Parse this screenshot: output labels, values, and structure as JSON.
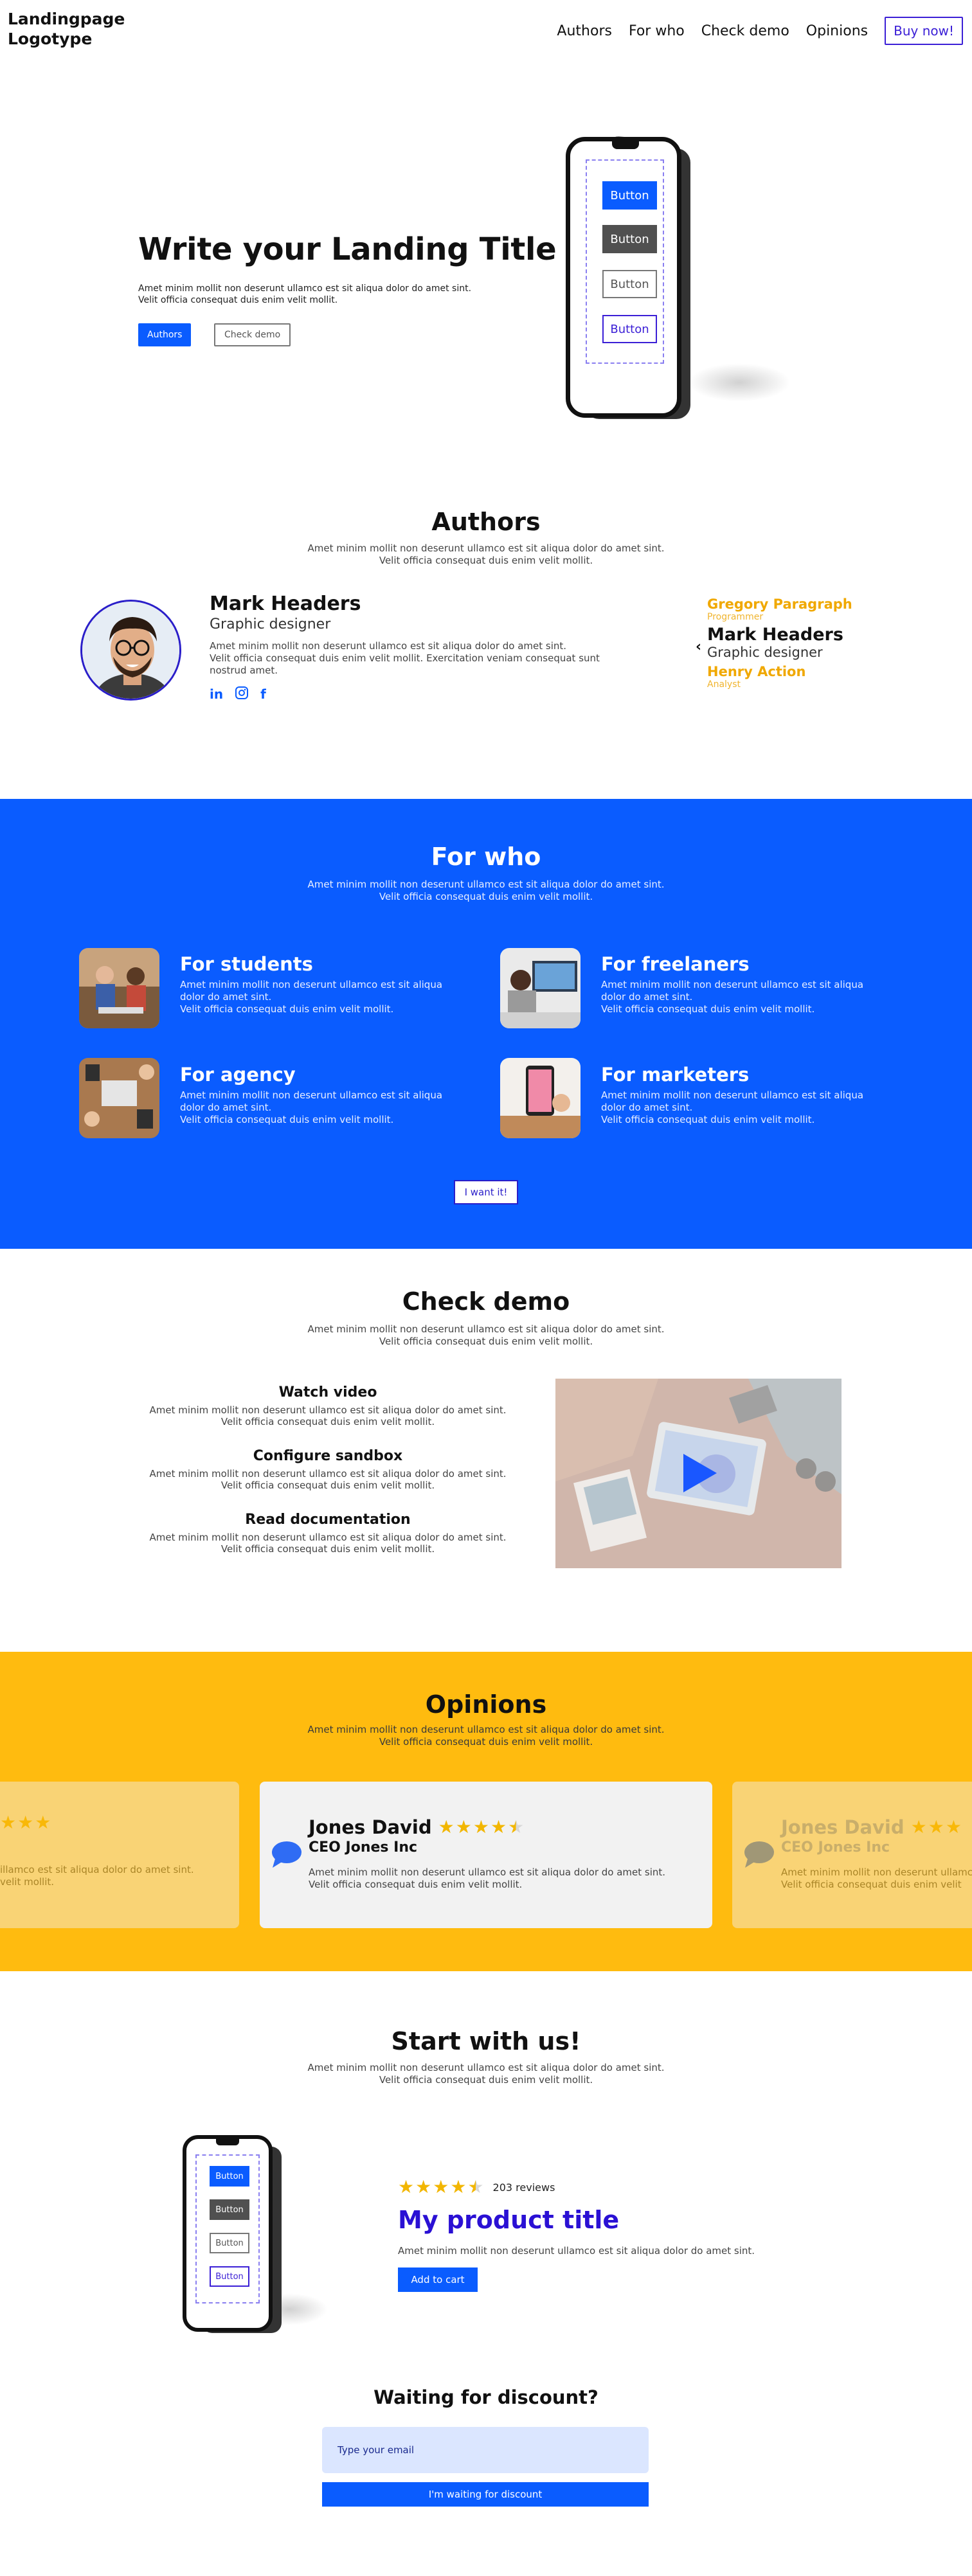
{
  "header": {
    "logo_line1": "Landingpage",
    "logo_line2": "Logotype",
    "nav": [
      "Authors",
      "For who",
      "Check demo",
      "Opinions"
    ],
    "buy_label": "Buy now!"
  },
  "hero": {
    "title": "Write your Landing Title",
    "text_line1": "Amet minim mollit non deserunt ullamco est sit aliqua dolor do amet sint.",
    "text_line2": "Velit officia consequat duis enim velit mollit.",
    "btn_authors": "Authors",
    "btn_demo": "Check demo",
    "phone_buttons": [
      "Button",
      "Button",
      "Button",
      "Button"
    ]
  },
  "authors": {
    "title": "Authors",
    "sub_line1": "Amet minim mollit non deserunt ullamco est sit aliqua dolor do amet sint.",
    "sub_line2": "Velit officia consequat duis enim velit mollit.",
    "featured": {
      "name": "Mark Headers",
      "role": "Graphic designer",
      "bio_line1": "Amet minim mollit non deserunt ullamco est sit aliqua dolor do amet sint.",
      "bio_line2": "Velit officia consequat duis enim velit mollit. Exercitation veniam consequat sunt",
      "bio_line3": "nostrud amet."
    },
    "list": [
      {
        "name": "Gregory Paragraph",
        "role": "Programmer"
      },
      {
        "name": "Mark Headers",
        "role": "Graphic designer"
      },
      {
        "name": "Henry Action",
        "role": "Analyst"
      }
    ],
    "prev_arrow": "‹"
  },
  "forwho": {
    "title": "For who",
    "sub_line1": "Amet minim mollit non deserunt ullamco est sit aliqua dolor do amet sint.",
    "sub_line2": "Velit officia consequat duis enim velit mollit.",
    "items": [
      {
        "title": "For students",
        "line1": "Amet minim mollit non deserunt ullamco est sit aliqua",
        "line2": "dolor do amet sint.",
        "line3": "Velit officia consequat duis enim velit mollit."
      },
      {
        "title": "For freelaners",
        "line1": "Amet minim mollit non deserunt ullamco est sit aliqua",
        "line2": "dolor do amet sint.",
        "line3": "Velit officia consequat duis enim velit mollit."
      },
      {
        "title": "For agency",
        "line1": "Amet minim mollit non deserunt ullamco est sit aliqua",
        "line2": "dolor do amet sint.",
        "line3": "Velit officia consequat duis enim velit mollit."
      },
      {
        "title": "For marketers",
        "line1": "Amet minim mollit non deserunt ullamco est sit aliqua",
        "line2": "dolor do amet sint.",
        "line3": "Velit officia consequat duis enim velit mollit."
      }
    ],
    "cta": "I want it!"
  },
  "demo": {
    "title": "Check demo",
    "sub_line1": "Amet minim mollit non deserunt ullamco est sit aliqua dolor do amet sint.",
    "sub_line2": "Velit officia consequat duis enim velit mollit.",
    "items": [
      {
        "heading": "Watch video",
        "line1": "Amet minim mollit non deserunt ullamco est sit aliqua dolor do amet sint.",
        "line2": "Velit officia consequat duis enim velit mollit."
      },
      {
        "heading": "Configure sandbox",
        "line1": "Amet minim mollit non deserunt ullamco est sit aliqua dolor do amet sint.",
        "line2": "Velit officia consequat duis enim velit mollit."
      },
      {
        "heading": "Read documentation",
        "line1": "Amet minim mollit non deserunt ullamco est sit aliqua dolor do amet sint.",
        "line2": "Velit officia consequat duis enim velit mollit."
      }
    ]
  },
  "opinions": {
    "title": "Opinions",
    "sub_line1": "Amet minim mollit non deserunt ullamco est sit aliqua dolor do amet sint.",
    "sub_line2": "Velit officia consequat duis enim velit mollit.",
    "left_partial_line1": "illamco est sit aliqua dolor do amet sint.",
    "left_partial_line2": "velit mollit.",
    "main": {
      "name": "Jones David",
      "company": "CEO Jones Inc",
      "rating": 4.5,
      "line1": "Amet minim mollit non deserunt ullamco est sit aliqua dolor do amet sint.",
      "line2": "Velit officia consequat duis enim velit mollit."
    },
    "right": {
      "name": "Jones David",
      "company": "CEO Jones Inc",
      "line1": "Amet minim mollit non deserunt ullamco",
      "line2": "Velit officia consequat duis enim velit"
    }
  },
  "start": {
    "title": "Start with us!",
    "sub_line1": "Amet minim mollit non deserunt ullamco est sit aliqua dolor do amet sint.",
    "sub_line2": "Velit officia consequat duis enim velit mollit.",
    "rating": 4.5,
    "reviews": "203 reviews",
    "product_title": "My product title",
    "product_text": "Amet minim mollit non deserunt ullamco est sit aliqua dolor do amet sint.",
    "add_to_cart": "Add to cart",
    "phone_buttons": [
      "Button",
      "Button",
      "Button",
      "Button"
    ]
  },
  "discount": {
    "title": "Waiting for discount?",
    "placeholder": "Type your email",
    "button": "I'm waiting for discount"
  },
  "colors": {
    "primary": "#0a5cff",
    "accent_violet": "#3b1fd6",
    "yellow": "#ffbb0f",
    "star": "#f2b600",
    "author_name_gold": "#f0a800"
  }
}
